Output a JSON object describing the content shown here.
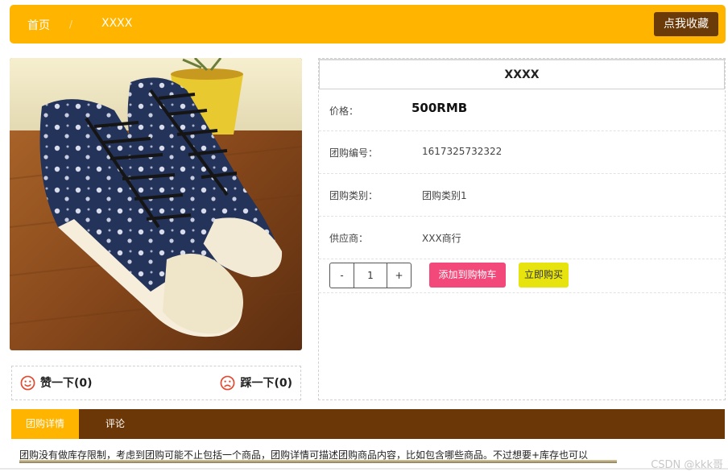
{
  "breadcrumb": {
    "home": "首页",
    "separator": "/",
    "current": "XXXX"
  },
  "header": {
    "favorite_label": "点我收藏"
  },
  "colors": {
    "accent": "#ffb400",
    "brown": "#6b3706",
    "cart": "#f2497a",
    "buy": "#e6e30e"
  },
  "product": {
    "image_alt_icon": "sneaker-photo",
    "title": "XXXX",
    "fields": [
      {
        "label": "价格：",
        "value": "500RMB"
      },
      {
        "label": "团购编号：",
        "value": "1617325732322"
      },
      {
        "label": "团购类别：",
        "value": "团购类别1"
      },
      {
        "label": "供应商：",
        "value": "XXX商行"
      }
    ]
  },
  "quantity": {
    "minus": "-",
    "value": "1",
    "plus": "+"
  },
  "actions": {
    "add_to_cart": "添加到购物车",
    "buy_now": "立即购买"
  },
  "votes": {
    "like": "赞一下(0)",
    "dislike": "踩一下(0)"
  },
  "tabs": [
    {
      "label": "团购详情",
      "active": true
    },
    {
      "label": "评论",
      "active": false
    }
  ],
  "description": "团购没有做库存限制，考虑到团购可能不止包括一个商品，团购详情可描述团购商品内容，比如包含哪些商品。不过想要+库存也可以",
  "watermark": "CSDN @kkk哥"
}
